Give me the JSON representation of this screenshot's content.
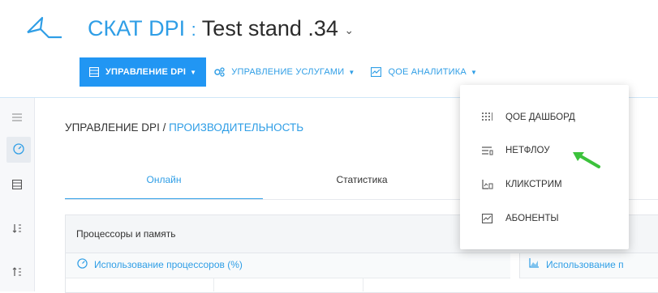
{
  "header": {
    "brand": "СКАТ DPI",
    "separator": ":",
    "stand": "Test stand .34",
    "caret": "⌄"
  },
  "nav": {
    "items": [
      {
        "label": "УПРАВЛЕНИЕ DPI",
        "icon": "table-icon",
        "active": true
      },
      {
        "label": "УПРАВЛЕНИЕ УСЛУГАМИ",
        "icon": "services-icon",
        "active": false
      },
      {
        "label": "QOE АНАЛИТИКА",
        "icon": "analytics-icon",
        "active": false,
        "open": true
      }
    ],
    "caret": "▼"
  },
  "sidebar": {
    "items": [
      "menu-icon",
      "dashboard-icon",
      "table-icon",
      "sort-icon",
      "sort-alt-icon"
    ]
  },
  "breadcrumb": {
    "part1": "УПРАВЛЕНИЕ DPI / ",
    "part2": "ПРОИЗВОДИТЕЛЬНОСТЬ"
  },
  "tabs": [
    {
      "label": "Онлайн",
      "active": true
    },
    {
      "label": "Статистика",
      "active": false
    }
  ],
  "panel": {
    "title": "Процессоры и память",
    "cpu_label": "Использование процессоров (%)",
    "mem_label": "Использование п"
  },
  "dropdown": {
    "items": [
      {
        "label": "QOE ДАШБОРД",
        "icon": "grid-icon"
      },
      {
        "label": "НЕТФЛОУ",
        "icon": "netflow-icon"
      },
      {
        "label": "КЛИКСТРИМ",
        "icon": "clickstream-icon"
      },
      {
        "label": "АБОНЕНТЫ",
        "icon": "subscribers-icon"
      }
    ]
  },
  "colors": {
    "accent": "#2196f3",
    "link": "#2f9ee6",
    "arrow": "#3cc23c"
  }
}
